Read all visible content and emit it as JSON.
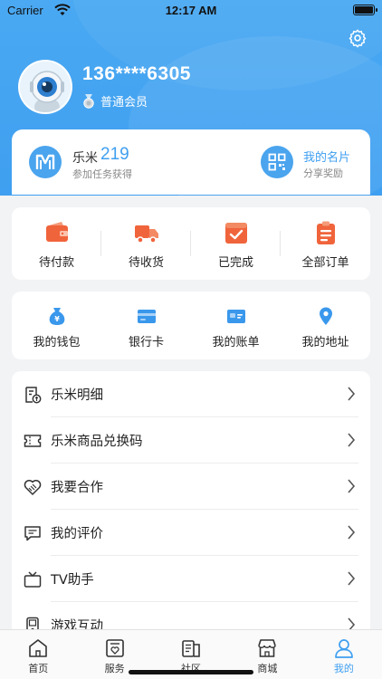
{
  "status_bar": {
    "carrier": "Carrier",
    "time": "12:17 AM"
  },
  "profile": {
    "phone": "136****6305",
    "member_level": "普通会员"
  },
  "points": {
    "name": "乐米",
    "count": "219",
    "subtitle": "参加任务获得"
  },
  "business_card": {
    "title": "我的名片",
    "subtitle": "分享奖励"
  },
  "orders": [
    {
      "label": "待付款",
      "icon": "wallet-icon"
    },
    {
      "label": "待收货",
      "icon": "truck-icon"
    },
    {
      "label": "已完成",
      "icon": "check-box-icon"
    },
    {
      "label": "全部订单",
      "icon": "clipboard-icon"
    }
  ],
  "wallet_row": [
    {
      "label": "我的钱包",
      "icon": "money-bag-icon"
    },
    {
      "label": "银行卡",
      "icon": "bank-card-icon"
    },
    {
      "label": "我的账单",
      "icon": "bill-icon"
    },
    {
      "label": "我的地址",
      "icon": "location-pin-icon"
    }
  ],
  "menu": [
    {
      "label": "乐米明细",
      "icon": "points-detail-icon"
    },
    {
      "label": "乐米商品兑换码",
      "icon": "ticket-icon"
    },
    {
      "label": "我要合作",
      "icon": "handshake-icon"
    },
    {
      "label": "我的评价",
      "icon": "comment-icon"
    },
    {
      "label": "TV助手",
      "icon": "tv-icon"
    },
    {
      "label": "游戏互动",
      "icon": "game-icon"
    }
  ],
  "tabs": [
    {
      "label": "首页",
      "icon": "home-icon",
      "active": false
    },
    {
      "label": "服务",
      "icon": "service-icon",
      "active": false
    },
    {
      "label": "社区",
      "icon": "community-icon",
      "active": false
    },
    {
      "label": "商城",
      "icon": "store-icon",
      "active": false
    },
    {
      "label": "我的",
      "icon": "person-icon",
      "active": true
    }
  ],
  "colors": {
    "primary": "#3f9ff0",
    "orange": "#f0643c",
    "icon_blue": "#3a98ec"
  }
}
